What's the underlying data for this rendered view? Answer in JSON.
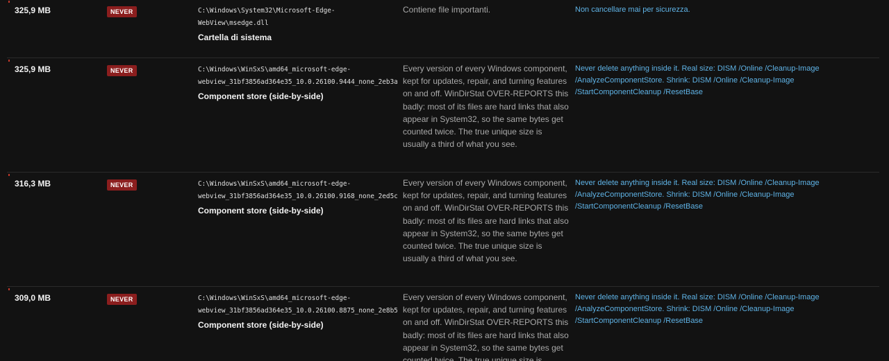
{
  "rows": [
    {
      "size": "325,9 MB",
      "badge": "NEVER",
      "path": "C:\\Windows\\System32\\Microsoft-Edge-\nWebView\\msedge.dll",
      "label": "Cartella di sistema",
      "description": "Contiene file importanti.",
      "advice": "Non cancellare mai per sicurezza."
    },
    {
      "size": "325,9 MB",
      "badge": "NEVER",
      "path": "C:\\Windows\\WinSxS\\amd64_microsoft-edge-\nwebview_31bf3856ad364e35_10.0.26100.9444_none_2eb3a",
      "label": "Component store (side-by-side)",
      "description": "Every version of every Windows component, kept for updates, repair, and turning features on and off. WinDirStat OVER-REPORTS this badly: most of its files are hard links that also appear in System32, so the same bytes get counted twice. The true unique size is usually a third of what you see.",
      "advice": "Never delete anything inside it. Real size: DISM /Online /Cleanup-Image /AnalyzeComponentStore. Shrink: DISM /Online /Cleanup-Image /StartComponentCleanup /ResetBase"
    },
    {
      "size": "316,3 MB",
      "badge": "NEVER",
      "path": "C:\\Windows\\WinSxS\\amd64_microsoft-edge-\nwebview_31bf3856ad364e35_10.0.26100.9168_none_2ed5c",
      "label": "Component store (side-by-side)",
      "description": "Every version of every Windows component, kept for updates, repair, and turning features on and off. WinDirStat OVER-REPORTS this badly: most of its files are hard links that also appear in System32, so the same bytes get counted twice. The true unique size is usually a third of what you see.",
      "advice": "Never delete anything inside it. Real size: DISM /Online /Cleanup-Image /AnalyzeComponentStore. Shrink: DISM /Online /Cleanup-Image /StartComponentCleanup /ResetBase"
    },
    {
      "size": "309,0 MB",
      "badge": "NEVER",
      "path": "C:\\Windows\\WinSxS\\amd64_microsoft-edge-\nwebview_31bf3856ad364e35_10.0.26100.8875_none_2e8b5",
      "label": "Component store (side-by-side)",
      "description": "Every version of every Windows component, kept for updates, repair, and turning features on and off. WinDirStat OVER-REPORTS this badly: most of its files are hard links that also appear in System32, so the same bytes get counted twice. The true unique size is usually a third of what you see.",
      "advice": "Never delete anything inside it. Real size: DISM /Online /Cleanup-Image /AnalyzeComponentStore. Shrink: DISM /Online /Cleanup-Image /StartComponentCleanup /ResetBase"
    }
  ],
  "colors": {
    "badge_bg": "#8b1e1e",
    "advice_text": "#5fb3e6",
    "description_text": "#a9a9a9",
    "background": "#121212"
  }
}
